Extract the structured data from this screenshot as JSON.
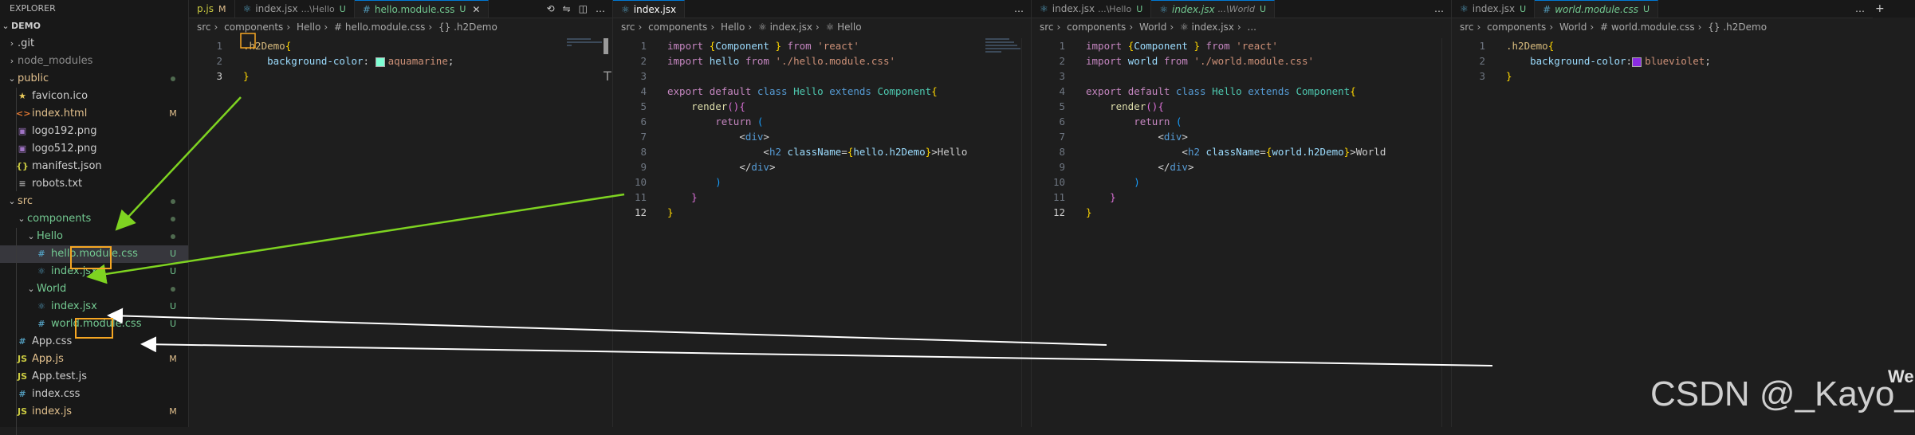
{
  "explorer": {
    "header": "EXPLORER",
    "root": "DEMO",
    "items": [
      {
        "name": ".git",
        "kind": "folder",
        "depth": 1,
        "expanded": false,
        "badge": "",
        "color": "#cccccc"
      },
      {
        "name": "node_modules",
        "kind": "folder",
        "depth": 1,
        "expanded": false,
        "badge": "",
        "color": "#8c8c8c"
      },
      {
        "name": "public",
        "kind": "folder",
        "depth": 1,
        "expanded": true,
        "badge": "dot",
        "color": "#e2c08d"
      },
      {
        "name": "favicon.ico",
        "kind": "file",
        "icon": "★",
        "icon_color": "#e8c95a",
        "depth": 2,
        "badge": "",
        "color": "#cccccc"
      },
      {
        "name": "index.html",
        "kind": "file",
        "icon": "<>",
        "icon_color": "#e37933",
        "depth": 2,
        "badge": "M",
        "color": "#e2c08d"
      },
      {
        "name": "logo192.png",
        "kind": "file",
        "icon": "▣",
        "icon_color": "#a074c4",
        "depth": 2,
        "badge": "",
        "color": "#cccccc"
      },
      {
        "name": "logo512.png",
        "kind": "file",
        "icon": "▣",
        "icon_color": "#a074c4",
        "depth": 2,
        "badge": "",
        "color": "#cccccc"
      },
      {
        "name": "manifest.json",
        "kind": "file",
        "icon": "{}",
        "icon_color": "#cbcb41",
        "depth": 2,
        "badge": "",
        "color": "#cccccc"
      },
      {
        "name": "robots.txt",
        "kind": "file",
        "icon": "≡",
        "icon_color": "#aaaaaa",
        "depth": 2,
        "badge": "",
        "color": "#cccccc"
      },
      {
        "name": "src",
        "kind": "folder",
        "depth": 1,
        "expanded": true,
        "badge": "dot",
        "color": "#e2c08d"
      },
      {
        "name": "components",
        "kind": "folder",
        "depth": 2,
        "expanded": true,
        "badge": "dot",
        "color": "#73c991"
      },
      {
        "name": "Hello",
        "kind": "folder",
        "depth": 3,
        "expanded": true,
        "badge": "dot",
        "color": "#73c991"
      },
      {
        "name": "hello.module.css",
        "kind": "file",
        "icon": "#",
        "icon_color": "#519aba",
        "depth": 4,
        "badge": "U",
        "color": "#73c991",
        "selected": true
      },
      {
        "name": "index.jsx",
        "kind": "file",
        "icon": "⚛",
        "icon_color": "#519aba",
        "depth": 4,
        "badge": "U",
        "color": "#73c991"
      },
      {
        "name": "World",
        "kind": "folder",
        "depth": 3,
        "expanded": true,
        "badge": "dot",
        "color": "#73c991"
      },
      {
        "name": "index.jsx",
        "kind": "file",
        "icon": "⚛",
        "icon_color": "#519aba",
        "depth": 4,
        "badge": "U",
        "color": "#73c991"
      },
      {
        "name": "world.module.css",
        "kind": "file",
        "icon": "#",
        "icon_color": "#519aba",
        "depth": 4,
        "badge": "U",
        "color": "#73c991"
      },
      {
        "name": "App.css",
        "kind": "file",
        "icon": "#",
        "icon_color": "#519aba",
        "depth": 2,
        "badge": "",
        "color": "#cccccc"
      },
      {
        "name": "App.js",
        "kind": "file",
        "icon": "JS",
        "icon_color": "#cbcb41",
        "depth": 2,
        "badge": "M",
        "color": "#e2c08d"
      },
      {
        "name": "App.test.js",
        "kind": "file",
        "icon": "JS",
        "icon_color": "#cbcb41",
        "depth": 2,
        "badge": "",
        "color": "#cccccc"
      },
      {
        "name": "index.css",
        "kind": "file",
        "icon": "#",
        "icon_color": "#519aba",
        "depth": 2,
        "badge": "",
        "color": "#cccccc"
      },
      {
        "name": "index.js",
        "kind": "file",
        "icon": "JS",
        "icon_color": "#cbcb41",
        "depth": 2,
        "badge": "M",
        "color": "#e2c08d"
      }
    ]
  },
  "groups": [
    {
      "tabs": [
        {
          "label": "p.js",
          "desc": "",
          "status": "M",
          "icon": "",
          "active": false
        },
        {
          "label": "index.jsx",
          "desc": "...\\Hello",
          "status": "U",
          "icon": "⚛",
          "active": false
        },
        {
          "label": "hello.module.css",
          "desc": "",
          "status": "U",
          "icon": "#",
          "active": true
        }
      ],
      "breadcrumb": [
        "src",
        "components",
        "Hello",
        "# hello.module.css",
        "{} .h2Demo"
      ],
      "file": "hello.module.css"
    },
    {
      "tabs": [
        {
          "label": "index.jsx",
          "desc": "",
          "status": "",
          "icon": "⚛",
          "active": true
        }
      ],
      "breadcrumb": [
        "src",
        "components",
        "Hello",
        "⚛ index.jsx",
        "⚛ Hello"
      ],
      "file": "Hello/index.jsx"
    },
    {
      "tabs": [
        {
          "label": "index.jsx",
          "desc": "...\\Hello",
          "status": "U",
          "icon": "⚛",
          "active": false
        },
        {
          "label": "index.jsx",
          "desc": "...\\World",
          "status": "U",
          "icon": "⚛",
          "active": true
        }
      ],
      "breadcrumb": [
        "src",
        "components",
        "World",
        "⚛ index.jsx",
        "..."
      ],
      "file": "World/index.jsx"
    },
    {
      "tabs": [
        {
          "label": "index.jsx",
          "desc": "",
          "status": "U",
          "icon": "⚛",
          "active": false
        },
        {
          "label": "world.module.css",
          "desc": "",
          "status": "U",
          "icon": "#",
          "active": true
        }
      ],
      "breadcrumb": [
        "src",
        "components",
        "World",
        "# world.module.css",
        "{} .h2Demo"
      ],
      "file": "world.module.css"
    }
  ],
  "code": {
    "hello_css": {
      "current_line": 3,
      "selector": ".h2Demo",
      "property": "background-color",
      "value": "aquamarine",
      "swatch": "#7fffd4"
    },
    "hello_jsx": {
      "current_line": 12,
      "import1_name": "Component",
      "import1_from": "'react'",
      "import2_name": "hello",
      "import2_from": "'./hello.module.css'",
      "class_name": "Hello",
      "extends": "Component",
      "h2_expr": "hello.h2Demo",
      "h2_text": "Hello"
    },
    "world_jsx": {
      "current_line": 12,
      "import1_name": "Component",
      "import1_from": "'react'",
      "import2_name": "world",
      "import2_from": "'./world.module.css'",
      "class_name": "Hello",
      "extends": "Component",
      "h2_expr": "world.h2Demo",
      "h2_text": "World"
    },
    "world_css": {
      "current_line": 3,
      "selector": ".h2Demo",
      "property": "background-color",
      "value": "blueviolet",
      "swatch": "#8a2be2"
    }
  },
  "overlay": {
    "watermark": "CSDN @_Kayo_c",
    "corner_text": "We",
    "arrow_green": "#7ed321",
    "arrow_white": "#ffffff",
    "highlight_box": "#f5a623"
  }
}
